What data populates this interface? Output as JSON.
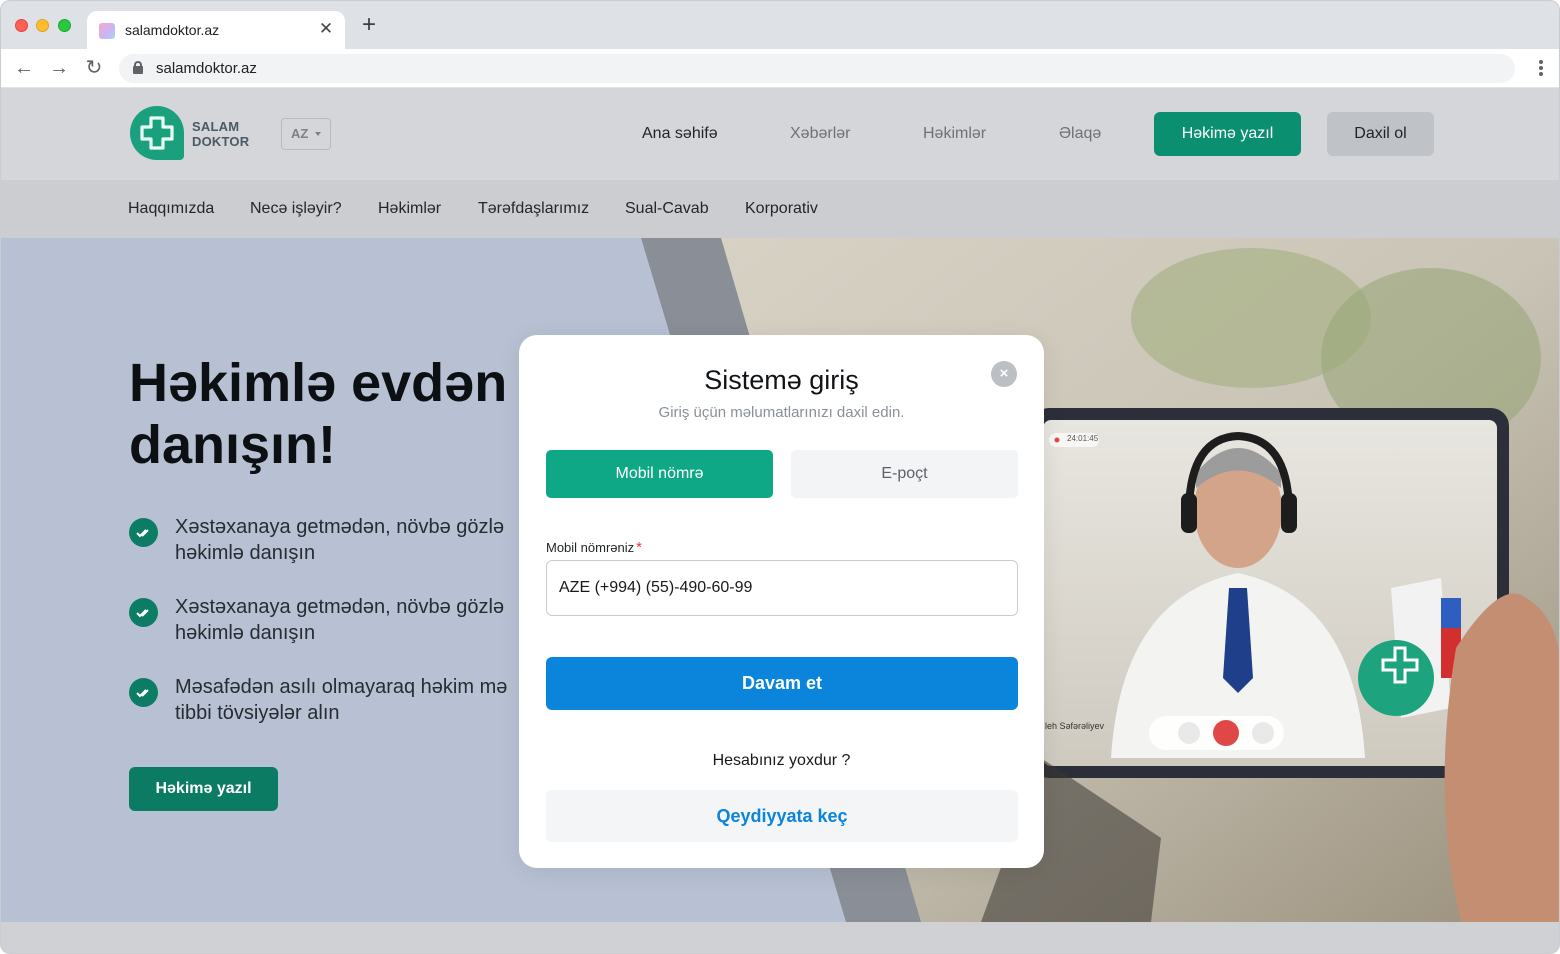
{
  "browser": {
    "tab_title": "salamdoktor.az",
    "tab_close": "✕",
    "new_tab": "+",
    "url": "salamdoktor.az",
    "nav_back": "←",
    "nav_forward": "→",
    "nav_reload": "↻"
  },
  "header": {
    "logo_line1": "SALAM",
    "logo_line2": "DOKTOR",
    "language": "AZ",
    "nav": [
      "Ana səhifə",
      "Xəbərlər",
      "Həkimlər",
      "Əlaqə"
    ],
    "cta_write": "Həkimə yazıl",
    "cta_login": "Daxil ol"
  },
  "subnav": [
    "Haqqımızda",
    "Necə işləyir?",
    "Həkimlər",
    "Tərəfdaşlarımız",
    "Sual-Cavab",
    "Korporativ"
  ],
  "hero": {
    "title_line1": "Həkimlə evdən",
    "title_line2": "danışın!",
    "features": [
      "Xəstəxanaya getmədən, növbə gözlə həkimlə danışın",
      "Xəstəxanaya getmədən, növbə gözlə həkimlə danışın",
      "Məsafədən asılı olmayaraq həkim mə tibbi tövsiyələr alın"
    ],
    "cta": "Həkimə yazıl",
    "call_timer": "24:01:45",
    "doctor_caption": "leh Səfərəliyev"
  },
  "modal": {
    "title": "Sistemə giriş",
    "subtitle": "Giriş üçün məlumatlarınızı daxil edin.",
    "close": "×",
    "tab_phone": "Mobil nömrə",
    "tab_email": "E-poçt",
    "field_label": "Mobil nömrəniz",
    "required_mark": "*",
    "phone_value": "AZE (+994) (55)-490-60-99",
    "continue": "Davam et",
    "no_account": "Hesabınız yoxdur ?",
    "register": "Qeydiyyata keç"
  },
  "colors": {
    "brand_green": "#0ea886",
    "primary_blue": "#0b84db",
    "hero_bg": "#b7c1d3"
  }
}
